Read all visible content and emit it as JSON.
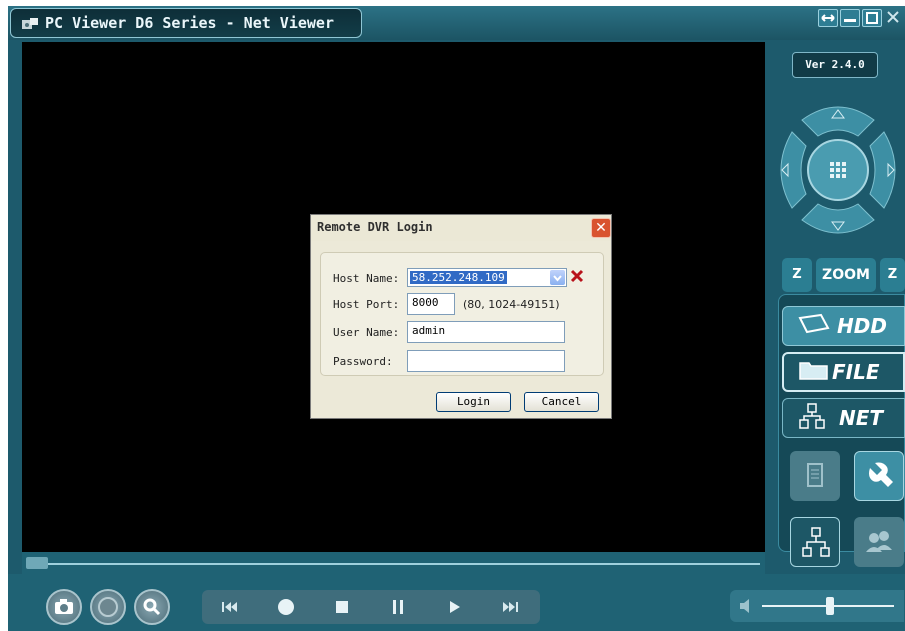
{
  "window": {
    "title": "PC Viewer D6 Series - Net Viewer"
  },
  "version": "Ver 2.4.0",
  "ptz": {
    "zoom_in": "Z",
    "zoom_label": "ZOOM",
    "zoom_out": "Z"
  },
  "modes": {
    "hdd": "HDD",
    "file": "FILE",
    "net": "NET"
  },
  "dialog": {
    "title": "Remote DVR Login",
    "host_name_label": "Host Name:",
    "host_name_value": "58.252.248.109",
    "host_port_label": "Host Port:",
    "host_port_value": "8000",
    "port_hint": "(80, 1024-49151)",
    "user_name_label": "User Name:",
    "user_name_value": "admin",
    "password_label": "Password:",
    "password_value": "",
    "login_button": "Login",
    "cancel_button": "Cancel"
  },
  "colors": {
    "accent": "#2b7e92",
    "panel": "#1d5a6c",
    "close_red": "#d9532f"
  }
}
